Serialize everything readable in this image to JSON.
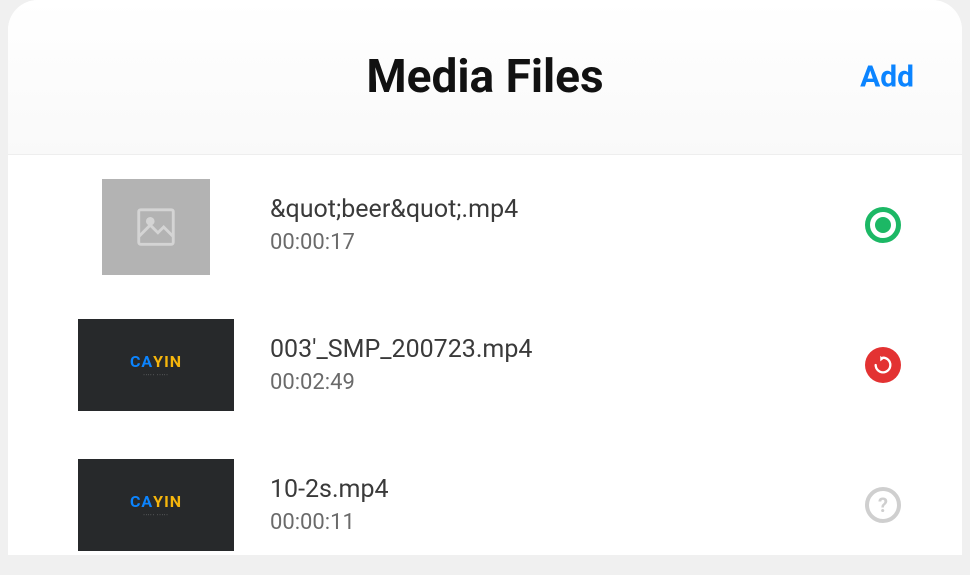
{
  "header": {
    "title": "Media Files",
    "add_label": "Add"
  },
  "items": [
    {
      "name": "&quot;beer&quot;.mp4",
      "duration": "00:00:17",
      "thumb_type": "placeholder",
      "status": "ok"
    },
    {
      "name": "003'_SMP_200723.mp4",
      "duration": "00:02:49",
      "thumb_type": "cayin",
      "status": "refresh"
    },
    {
      "name": "10-2s.mp4",
      "duration": "00:00:11",
      "thumb_type": "cayin",
      "status": "unknown"
    }
  ],
  "thumb_logo": {
    "part1": "CA",
    "part2": "YIN",
    "sub": "····· ·····"
  }
}
